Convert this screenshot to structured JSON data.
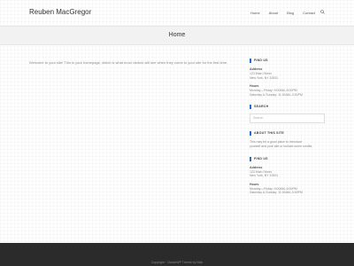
{
  "site": {
    "title": "Reuben MacGregor"
  },
  "nav": {
    "items": [
      {
        "label": "Home"
      },
      {
        "label": "About"
      },
      {
        "label": "Blog"
      },
      {
        "label": "Contact"
      }
    ],
    "search_icon": "search-icon"
  },
  "page": {
    "title": "Home",
    "intro": "Welcome to your site! This is your homepage, which is what most visitors will see when they come to your site for the first time."
  },
  "sidebar": {
    "find_us_1": {
      "title": "FIND US",
      "address_label": "Address",
      "address_line1": "123 Main Street",
      "address_line2": "New York, NY 10001",
      "hours_label": "Hours",
      "hours_line1": "Monday—Friday: 9:00AM–5:00PM",
      "hours_line2": "Saturday & Sunday: 11:00AM–3:00PM"
    },
    "search": {
      "title": "SEARCH",
      "placeholder": "Search"
    },
    "about": {
      "title": "ABOUT THIS SITE",
      "text_line1": "This may be a good place to introduce",
      "text_line2": "yourself and your site or include some credits."
    },
    "find_us_2": {
      "title": "FIND US",
      "address_label": "Address",
      "address_line1": "123 Main Street",
      "address_line2": "New York, NY 10001",
      "hours_label": "Hours",
      "hours_line1": "Monday—Friday: 9:00AM–5:00PM",
      "hours_line2": "Saturday & Sunday: 11:00AM–3:00PM"
    }
  },
  "footer": {
    "copyright": "Copyright · OceanWP Theme by Nick"
  },
  "colors": {
    "accent": "#2a6fbf",
    "footer_bg": "#2b2b2b",
    "page_header_bg": "#f2f2f2"
  }
}
